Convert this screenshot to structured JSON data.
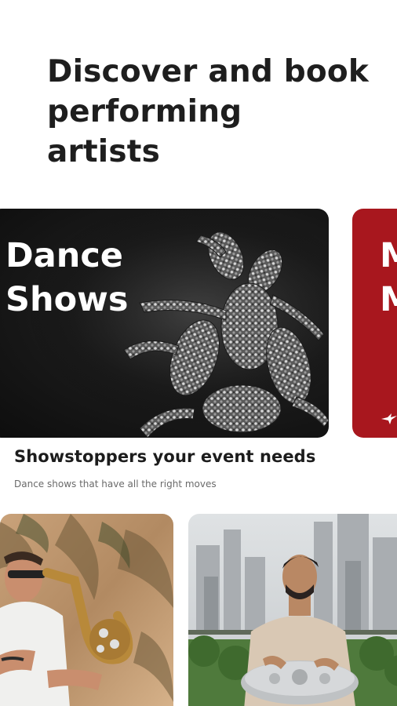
{
  "hero": {
    "line1": "Discover and book",
    "line2": "performing",
    "line3": "artists"
  },
  "carousel": {
    "cards": [
      {
        "line1": "Dance",
        "line2": "Shows",
        "background": "#111111"
      },
      {
        "line1": "M",
        "line2": "M",
        "background": "#a8171e"
      }
    ]
  },
  "section": {
    "title": "Showstoppers your event needs",
    "subtitle": "Dance shows that have all the right moves"
  },
  "colors": {
    "text": "#1c1c1c",
    "muted": "#6a6a6a",
    "brand_red": "#a8171e"
  },
  "photos": [
    {
      "subject": "saxophonist"
    },
    {
      "subject": "handpan player"
    }
  ],
  "icons": [
    "bird-logo-icon"
  ]
}
